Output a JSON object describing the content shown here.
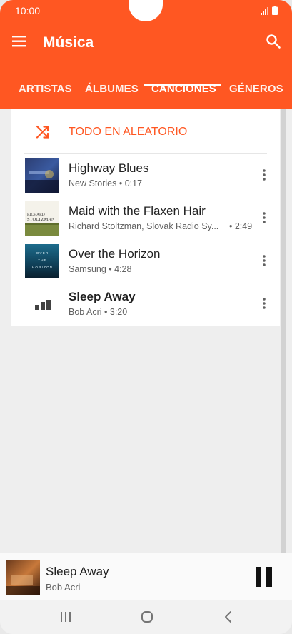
{
  "status_bar": {
    "time": "10:00"
  },
  "app_bar": {
    "title": "Música",
    "tabs": [
      {
        "label": "ARTISTAS"
      },
      {
        "label": "ÁLBUMES"
      },
      {
        "label": "CANCIONES",
        "selected": true
      },
      {
        "label": "GÉNEROS"
      }
    ]
  },
  "shuffle": {
    "label": "TODO EN ALEATORIO"
  },
  "songs": [
    {
      "title": "Highway Blues",
      "subtitle": "New Stories • 0:17",
      "art": "album-art-highway-blues"
    },
    {
      "title": "Maid with the Flaxen Hair",
      "subtitle_artist": "Richard Stoltzman, Slovak Radio Sy...",
      "subtitle_duration": "• 2:49",
      "art": "album-art-richard-stoltzman",
      "art_text": [
        "RICHARD",
        "STOLTZMAN"
      ]
    },
    {
      "title": "Over the Horizon",
      "subtitle": "Samsung • 4:28",
      "art": "album-art-over-the-horizon",
      "art_text": [
        "O V E R",
        "T H E",
        "H O R I Z O N"
      ]
    },
    {
      "title": "Sleep Away",
      "subtitle": "Bob Acri • 3:20",
      "playing": true,
      "art": "equalizer-icon"
    }
  ],
  "now_playing": {
    "title": "Sleep Away",
    "artist": "Bob Acri"
  },
  "colors": {
    "accent": "#ff5722",
    "background": "#eeeeee",
    "card": "#ffffff"
  }
}
